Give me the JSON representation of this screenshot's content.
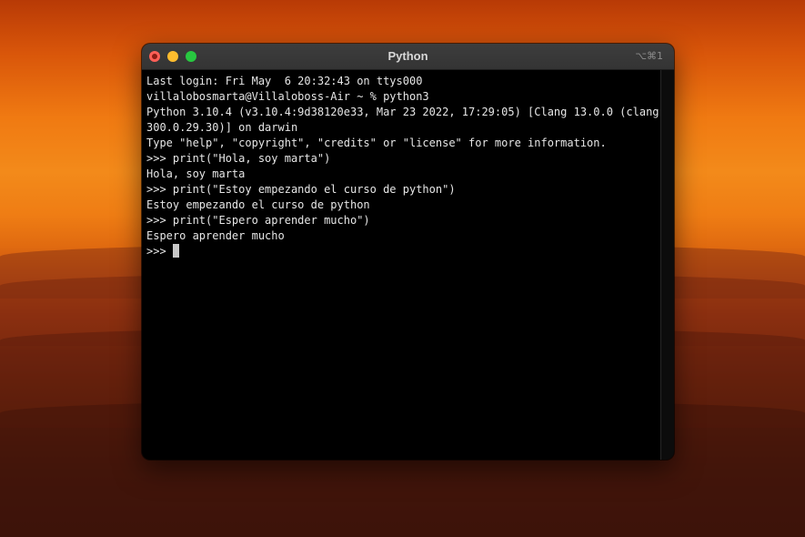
{
  "window": {
    "title": "Python",
    "shortcut": "⌥⌘1"
  },
  "terminal": {
    "lines": [
      "Last login: Fri May  6 20:32:43 on ttys000",
      "villalobosmarta@Villaloboss-Air ~ % python3",
      "Python 3.10.4 (v3.10.4:9d38120e33, Mar 23 2022, 17:29:05) [Clang 13.0.0 (clang-1",
      "300.0.29.30)] on darwin",
      "Type \"help\", \"copyright\", \"credits\" or \"license\" for more information.",
      ">>> print(\"Hola, soy marta\")",
      "Hola, soy marta",
      ">>> print(\"Estoy empezando el curso de python\")",
      "Estoy empezando el curso de python",
      ">>> print(\"Espero aprender mucho\")",
      "Espero aprender mucho"
    ],
    "prompt": ">>> "
  },
  "colors": {
    "close": "#ff5f57",
    "minimize": "#febc2e",
    "maximize": "#28c840",
    "terminal_bg": "#000000",
    "terminal_text": "#e6e6e6"
  }
}
